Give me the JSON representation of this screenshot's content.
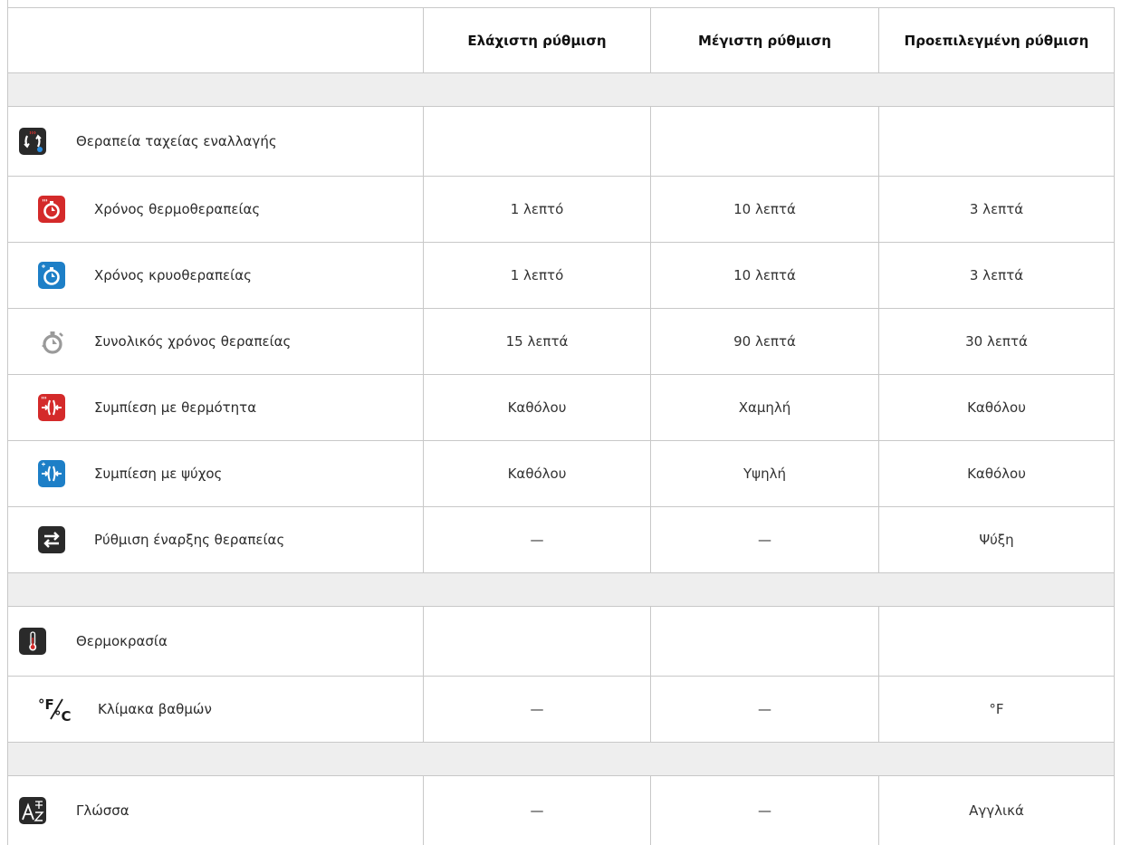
{
  "table": {
    "headers": {
      "min": "Ελάχιστη ρύθμιση",
      "max": "Μέγιστη ρύθμιση",
      "default": "Προεπιλεγμένη ρύθμιση"
    },
    "groups": [
      {
        "title": {
          "label": "Θεραπεία ταχείας εναλλαγής",
          "icon": "rapid-alternation-icon"
        },
        "rows": [
          {
            "label": "Χρόνος θερμοθεραπείας",
            "icon": "heat-timer-icon",
            "min": "1 λεπτό",
            "max": "10 λεπτά",
            "default": "3 λεπτά"
          },
          {
            "label": "Χρόνος κρυοθεραπείας",
            "icon": "cold-timer-icon",
            "min": "1 λεπτό",
            "max": "10 λεπτά",
            "default": "3 λεπτά"
          },
          {
            "label": "Συνολικός χρόνος θεραπείας",
            "icon": "total-timer-icon",
            "min": "15 λεπτά",
            "max": "90 λεπτά",
            "default": "30 λεπτά"
          },
          {
            "label": "Συμπίεση με θερμότητα",
            "icon": "heat-compression-icon",
            "min": "Καθόλου",
            "max": "Χαμηλή",
            "default": "Καθόλου"
          },
          {
            "label": "Συμπίεση με ψύχος",
            "icon": "cold-compression-icon",
            "min": "Καθόλου",
            "max": "Υψηλή",
            "default": "Καθόλου"
          },
          {
            "label": "Ρύθμιση έναρξης θεραπείας",
            "icon": "start-setting-icon",
            "min": "—",
            "max": "—",
            "default": "Ψύξη"
          }
        ]
      },
      {
        "title": {
          "label": "Θερμοκρασία",
          "icon": "thermometer-icon"
        },
        "rows": [
          {
            "label": "Κλίμακα βαθμών",
            "icon": "degree-scale-icon",
            "icon_text": {
              "f": "°F",
              "c": "°C"
            },
            "min": "—",
            "max": "—",
            "default": "°F"
          }
        ]
      },
      {
        "title": {
          "label": "Γλώσσα",
          "icon": "language-icon",
          "min": "—",
          "max": "—",
          "default": "Αγγλικά"
        },
        "rows": []
      }
    ]
  },
  "colors": {
    "border": "#c8c8c8",
    "section_fill": "#eeeeee",
    "heat_red": "#d42a2a",
    "cold_blue": "#1d7fc7",
    "dark_icon": "#2a2a2a",
    "gray_icon": "#9a9a9a"
  }
}
